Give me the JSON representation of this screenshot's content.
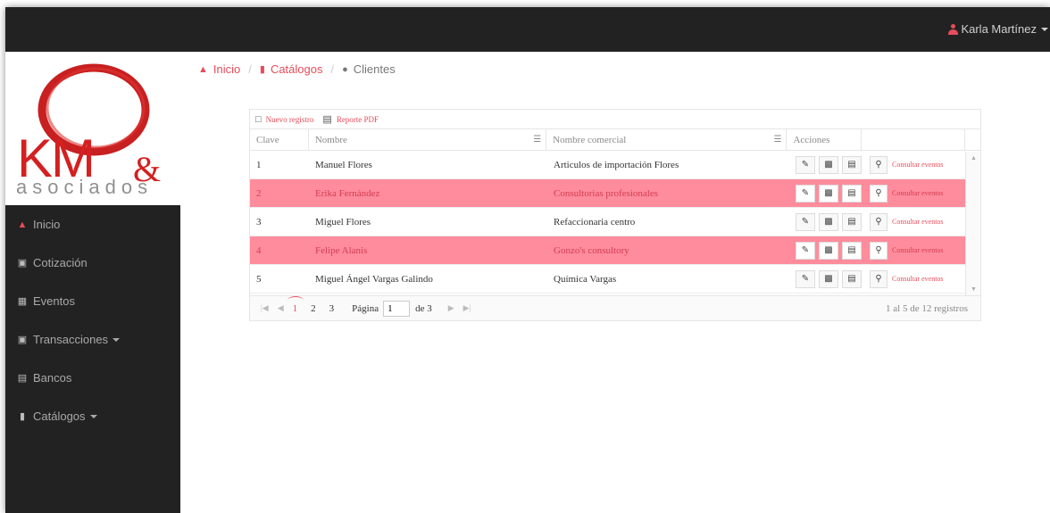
{
  "user": {
    "name": "Karla Martínez"
  },
  "logo": {
    "main": "KM",
    "amp": "&",
    "sub": "asociados"
  },
  "sidebar": {
    "items": [
      {
        "label": "Inicio",
        "icon": "home-icon"
      },
      {
        "label": "Cotización",
        "icon": "cart-icon"
      },
      {
        "label": "Eventos",
        "icon": "calendar-icon"
      },
      {
        "label": "Transacciones",
        "icon": "money-icon",
        "dropdown": true
      },
      {
        "label": "Bancos",
        "icon": "bank-icon"
      },
      {
        "label": "Catálogos",
        "icon": "book-icon",
        "dropdown": true
      }
    ]
  },
  "breadcrumb": {
    "home": "Inicio",
    "section": "Catálogos",
    "current": "Clientes"
  },
  "toolbar": {
    "new_label": "Nuevo registro",
    "pdf_label": "Reporte PDF"
  },
  "table": {
    "headers": {
      "clave": "Clave",
      "nombre": "Nombre",
      "comercial": "Nombre comercial",
      "acciones": "Acciones"
    },
    "consult_label": "Consultar eventos",
    "rows": [
      {
        "clave": "1",
        "nombre": "Manuel Flores",
        "comercial": "Articulos de importación Flores",
        "highlight": false
      },
      {
        "clave": "2",
        "nombre": "Erika Fernández",
        "comercial": "Consultorias profesionales",
        "highlight": true
      },
      {
        "clave": "3",
        "nombre": "Miguel Flores",
        "comercial": "Refaccionaria centro",
        "highlight": false
      },
      {
        "clave": "4",
        "nombre": "Felipe Alanis",
        "comercial": "Gonzo's consultory",
        "highlight": true
      },
      {
        "clave": "5",
        "nombre": "Miguel Ángel Vargas Galindo",
        "comercial": "Química Vargas",
        "highlight": false
      }
    ]
  },
  "pager": {
    "pages": [
      "1",
      "2",
      "3"
    ],
    "page_label": "Página",
    "page_value": "1",
    "of_label": "de 3",
    "info": "1 al 5 de 12 registros"
  },
  "colors": {
    "accent": "#e74c5b",
    "highlight_row": "#ff8c9c",
    "dark": "#222222"
  }
}
